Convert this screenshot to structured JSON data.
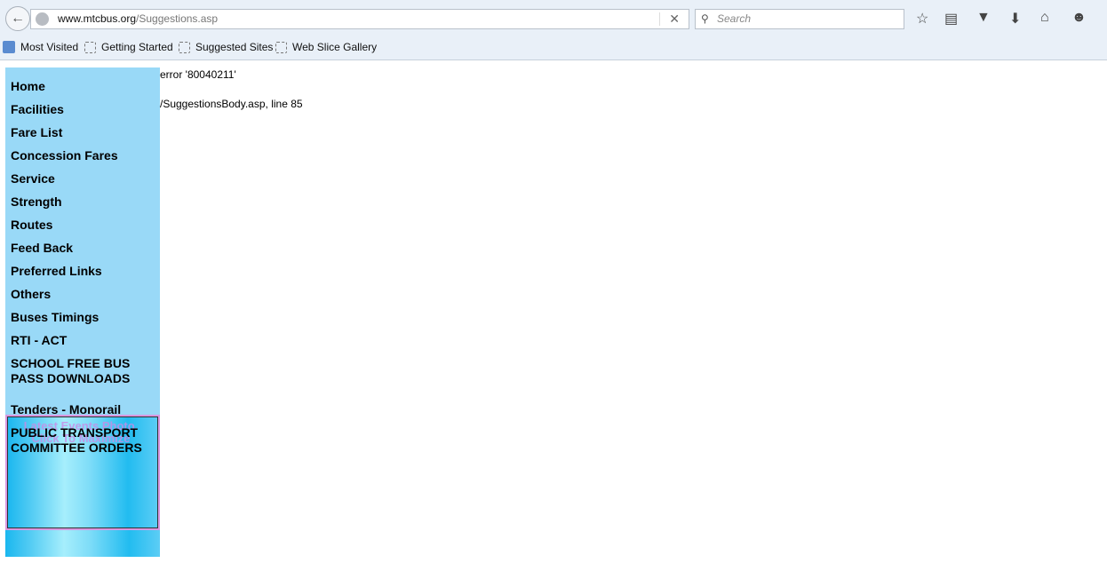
{
  "browser": {
    "url_domain": "www.mtcbus.org",
    "url_path": "/Suggestions.asp",
    "search_placeholder": "Search",
    "bookmarks": [
      "Most Visited",
      "Getting Started",
      "Suggested Sites",
      "Web Slice Gallery"
    ]
  },
  "sidebar": {
    "items": [
      "Home",
      "Facilities",
      "Fare List",
      "Concession Fares",
      "Service",
      "Strength",
      "Routes",
      "Feed Back",
      "Preferred Links",
      "Others",
      "Buses Timings",
      "RTI - ACT",
      "SCHOOL FREE BUS PASS DOWNLOADS",
      "Tenders - Monorail",
      "PUBLIC TRANSPORT COMMITTEE ORDERS"
    ],
    "photo_alt": "Latest Events Photo. Click To Maximize"
  },
  "main": {
    "error_line": "error '80040211'",
    "location_line": "/SuggestionsBody.asp, line 85"
  }
}
